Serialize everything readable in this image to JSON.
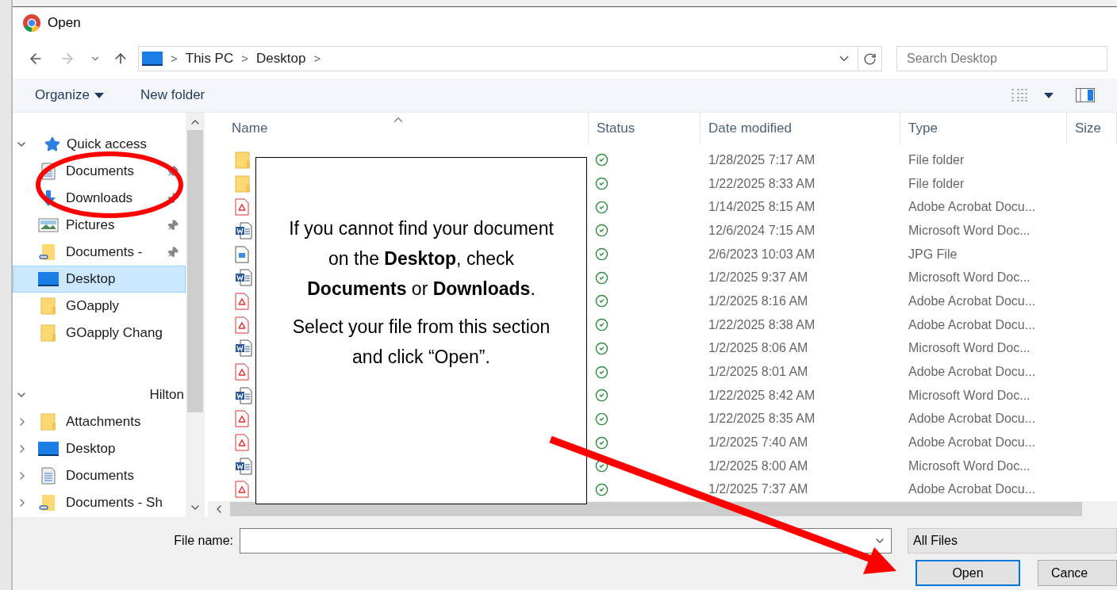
{
  "window": {
    "title": "Open"
  },
  "address": {
    "crumbs": [
      "This PC",
      "Desktop"
    ],
    "separator": ">"
  },
  "search": {
    "placeholder": "Search Desktop"
  },
  "toolbar": {
    "organize": "Organize",
    "new_folder": "New folder"
  },
  "sidebar": {
    "sections": [
      {
        "label": "Quick access",
        "kind": "quick",
        "expanded": true,
        "items": [
          {
            "label": "Documents",
            "kind": "documents",
            "pinned": true,
            "selected": false
          },
          {
            "label": "Downloads",
            "kind": "downloads",
            "pinned": true,
            "selected": false
          },
          {
            "label": "Pictures",
            "kind": "pictures",
            "pinned": true,
            "selected": false
          },
          {
            "label": "Documents -",
            "kind": "shared",
            "pinned": true,
            "selected": false
          },
          {
            "label": "Desktop",
            "kind": "desktop",
            "pinned": false,
            "selected": true
          },
          {
            "label": "GOapply",
            "kind": "folder",
            "pinned": false,
            "selected": false
          },
          {
            "label": "GOapply Chang",
            "kind": "folder",
            "pinned": false,
            "selected": false
          }
        ]
      },
      {
        "label": "Hilton",
        "kind": "user",
        "expanded": true,
        "items": [
          {
            "label": "Attachments",
            "kind": "folder",
            "expanded": false,
            "selected": false
          },
          {
            "label": "Desktop",
            "kind": "desktop",
            "expanded": false,
            "selected": false
          },
          {
            "label": "Documents",
            "kind": "documents",
            "expanded": false,
            "selected": false
          },
          {
            "label": "Documents - Sh",
            "kind": "shared",
            "expanded": false,
            "selected": false
          }
        ]
      }
    ]
  },
  "table": {
    "columns": [
      {
        "label": "Name",
        "sorted": true
      },
      {
        "label": "Status",
        "sorted": false
      },
      {
        "label": "Date modified",
        "sorted": false
      },
      {
        "label": "Type",
        "sorted": false
      },
      {
        "label": "Size",
        "sorted": false
      }
    ],
    "rows": [
      {
        "kind": "folder",
        "synced": true,
        "date": "1/28/2025 7:17 AM",
        "type": "File folder"
      },
      {
        "kind": "folder",
        "synced": true,
        "date": "1/22/2025 8:33 AM",
        "type": "File folder"
      },
      {
        "kind": "pdf",
        "synced": true,
        "date": "1/14/2025 8:15 AM",
        "type": "Adobe Acrobat Docu..."
      },
      {
        "kind": "word",
        "synced": true,
        "date": "12/6/2024 7:15 AM",
        "type": "Microsoft Word Doc..."
      },
      {
        "kind": "image",
        "synced": true,
        "date": "2/6/2023 10:03 AM",
        "type": "JPG File"
      },
      {
        "kind": "word",
        "synced": true,
        "date": "1/2/2025 9:37 AM",
        "type": "Microsoft Word Doc..."
      },
      {
        "kind": "pdf",
        "synced": true,
        "date": "1/2/2025 8:16 AM",
        "type": "Adobe Acrobat Docu..."
      },
      {
        "kind": "pdf",
        "synced": true,
        "date": "1/22/2025 8:38 AM",
        "type": "Adobe Acrobat Docu..."
      },
      {
        "kind": "word",
        "synced": true,
        "date": "1/2/2025 8:06 AM",
        "type": "Microsoft Word Doc..."
      },
      {
        "kind": "pdf",
        "synced": true,
        "date": "1/2/2025 8:01 AM",
        "type": "Adobe Acrobat Docu..."
      },
      {
        "kind": "word",
        "synced": true,
        "date": "1/22/2025 8:42 AM",
        "type": "Microsoft Word Doc..."
      },
      {
        "kind": "pdf",
        "synced": true,
        "date": "1/22/2025 8:35 AM",
        "type": "Adobe Acrobat Docu..."
      },
      {
        "kind": "pdf",
        "synced": true,
        "date": "1/2/2025 7:40 AM",
        "type": "Adobe Acrobat Docu..."
      },
      {
        "kind": "word",
        "synced": true,
        "date": "1/2/2025 8:00 AM",
        "type": "Microsoft Word Doc..."
      },
      {
        "kind": "pdf",
        "synced": true,
        "date": "1/2/2025 7:37 AM",
        "type": "Adobe Acrobat Docu..."
      }
    ]
  },
  "footer": {
    "file_name_label": "File name:",
    "filter": "All Files",
    "buttons": [
      "Open",
      "Cance"
    ]
  },
  "callout": {
    "paragraphs": [
      "If you cannot find your document on the **Desktop**, check **Documents** or **Downloads**.",
      "Select your file from this section and click “Open”."
    ]
  }
}
